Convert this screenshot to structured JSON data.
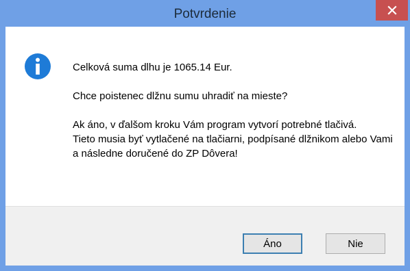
{
  "window": {
    "title": "Potvrdenie",
    "close_glyph": "×"
  },
  "message": {
    "icon": "info-icon",
    "line1": "Celková suma dlhu je 1065.14 Eur.",
    "line2": "Chce poistenec dlžnu sumu uhradiť na mieste?",
    "line3": "Ak áno, v ďalšom kroku Vám program vytvorí potrebné tlačivá.",
    "line4": "Tieto musia byť vytlačené na tlačiarni, podpísané dlžnikom alebo Vami",
    "line5": "a následne doručené do ZP Dôvera!"
  },
  "buttons": {
    "yes_label": "Áno",
    "no_label": "Nie"
  },
  "colors": {
    "titlebar": "#6fa0e6",
    "close_button": "#c75050",
    "info_icon": "#1e7bd7",
    "default_button_border": "#3c7fb1"
  }
}
